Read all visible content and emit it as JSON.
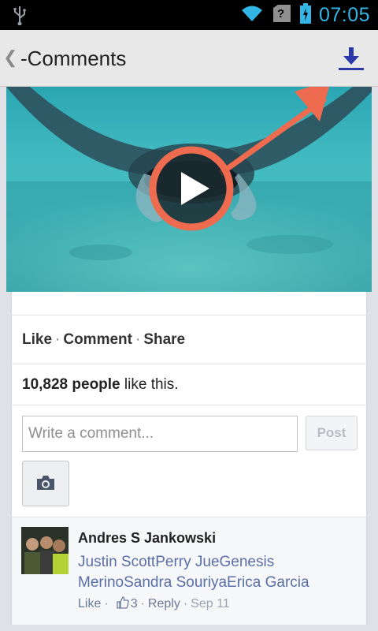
{
  "status_bar": {
    "time": "07:05",
    "icons": [
      "usb-icon",
      "wifi-icon",
      "no-sim-icon",
      "battery-icon"
    ]
  },
  "action_bar": {
    "title": "-Comments",
    "back_icon": "chevron-left-icon",
    "download_icon": "download-icon"
  },
  "video": {
    "play_icon": "play-icon",
    "annotation": "red-arrow-pointing-to-download"
  },
  "post_actions": {
    "like": "Like",
    "comment": "Comment",
    "share": "Share",
    "separator": "·"
  },
  "likes": {
    "count_text": "10,828 people",
    "suffix": " like this."
  },
  "composer": {
    "placeholder": "Write a comment...",
    "post_label": "Post",
    "camera_icon": "camera-icon"
  },
  "comment": {
    "author": "Andres S Jankowski",
    "tags_line1": "Justin ScottPerry JueGenesis",
    "tags_line2": "MerinoSandra SouriyaErica Garcia",
    "like_label": "Like",
    "like_count": "3",
    "reply_label": "Reply",
    "date": "Sep 11",
    "separator": "·"
  },
  "colors": {
    "accent_blue": "#33b5e5",
    "download_blue": "#2b3aa8",
    "annotation_red": "#ef6b4f",
    "link_blue": "#5a6ea8"
  }
}
